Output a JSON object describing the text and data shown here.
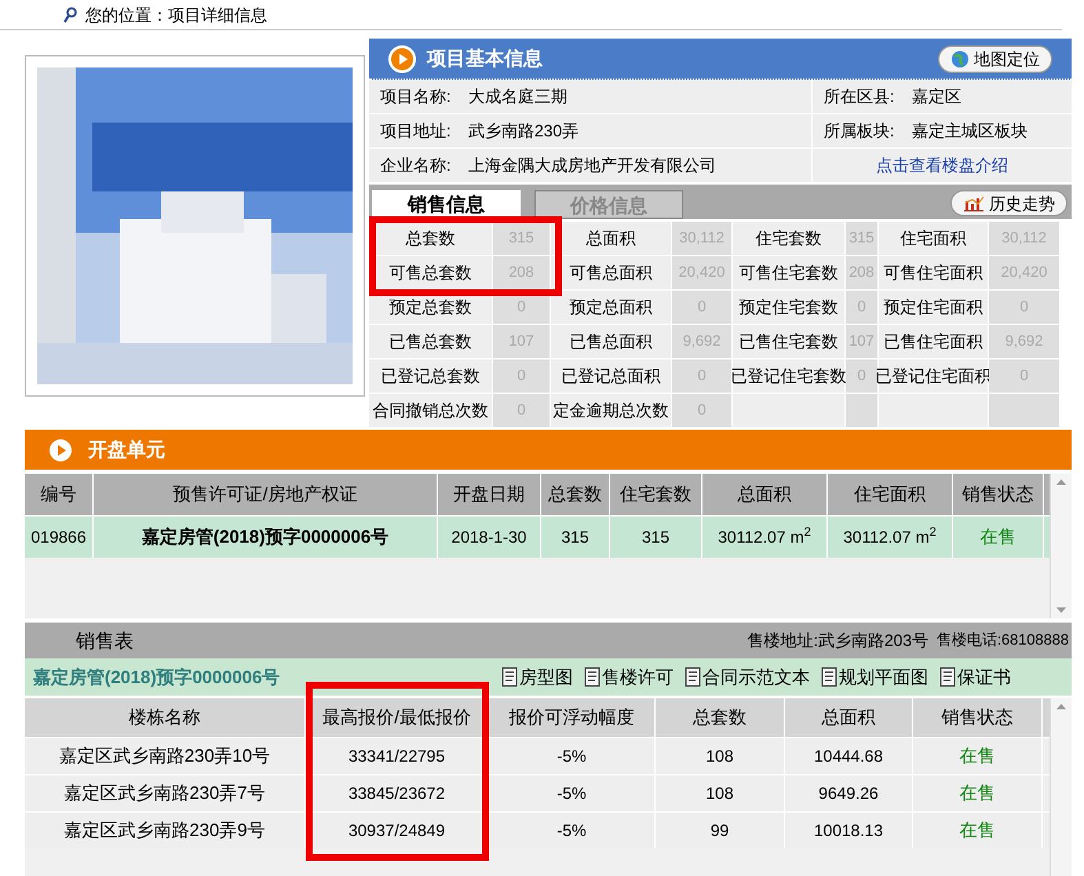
{
  "breadcrumb": "您的位置：项目详细信息",
  "project": {
    "title": "项目基本信息",
    "map_button": "地图定位",
    "rows": [
      {
        "pairs": [
          {
            "label": "项目名称:",
            "value": "大成名庭三期"
          },
          {
            "label": "所在区县:",
            "value": "嘉定区"
          }
        ]
      },
      {
        "pairs": [
          {
            "label": "项目地址:",
            "value": "武乡南路230弄"
          },
          {
            "label": "所属板块:",
            "value": "嘉定主城区板块"
          }
        ]
      },
      {
        "pairs": [
          {
            "label": "企业名称:",
            "value": "上海金隅大成房地产开发有限公司"
          }
        ],
        "link": "点击查看楼盘介绍"
      }
    ]
  },
  "tabs": [
    {
      "label": "销售信息",
      "selected": true
    },
    {
      "label": "价格信息",
      "selected": false
    }
  ],
  "history_button": "历史走势",
  "stats": [
    {
      "highlighted": true,
      "pairs": [
        {
          "label": "总套数",
          "value": "315"
        },
        {
          "label": "总面积",
          "value": "30,112"
        },
        {
          "label": "住宅套数",
          "value": "315"
        },
        {
          "label": "住宅面积",
          "value": "30,112"
        }
      ]
    },
    {
      "highlighted": true,
      "pairs": [
        {
          "label": "可售总套数",
          "value": "208"
        },
        {
          "label": "可售总面积",
          "value": "20,420"
        },
        {
          "label": "可售住宅套数",
          "value": "208"
        },
        {
          "label": "可售住宅面积",
          "value": "20,420"
        }
      ]
    },
    {
      "highlighted": false,
      "pairs": [
        {
          "label": "预定总套数",
          "value": "0"
        },
        {
          "label": "预定总面积",
          "value": "0"
        },
        {
          "label": "预定住宅套数",
          "value": "0"
        },
        {
          "label": "预定住宅面积",
          "value": "0"
        }
      ]
    },
    {
      "highlighted": false,
      "pairs": [
        {
          "label": "已售总套数",
          "value": "107"
        },
        {
          "label": "已售总面积",
          "value": "9,692"
        },
        {
          "label": "已售住宅套数",
          "value": "107"
        },
        {
          "label": "已售住宅面积",
          "value": "9,692"
        }
      ]
    },
    {
      "highlighted": false,
      "pairs": [
        {
          "label": "已登记总套数",
          "value": "0"
        },
        {
          "label": "已登记总面积",
          "value": "0"
        },
        {
          "label": "已登记住宅套数",
          "value": "0"
        },
        {
          "label": "已登记住宅面积",
          "value": "0"
        }
      ]
    },
    {
      "highlighted": false,
      "pairs": [
        {
          "label": "合同撤销总次数",
          "value": "0"
        },
        {
          "label": "定金逾期总次数",
          "value": "0"
        }
      ]
    }
  ],
  "units": {
    "title": "开盘单元",
    "columns": [
      "编号",
      "预售许可证/房地产权证",
      "开盘日期",
      "总套数",
      "住宅套数",
      "总面积",
      "住宅面积",
      "销售状态"
    ],
    "rows": [
      {
        "cells": [
          "019866",
          "嘉定房管(2018)预字0000006号",
          "2018-1-30",
          "315",
          "315",
          "30112.07 m$^{2}$",
          "30112.07 m$^{2}$",
          "在售"
        ]
      }
    ]
  },
  "sales": {
    "title": "销售表",
    "address": "售楼地址:武乡南路203号",
    "phone": "售楼电话:68108888",
    "permit": "嘉定房管(2018)预字0000006号",
    "links": [
      "房型图",
      "售楼许可",
      "合同示范文本",
      "规划平面图",
      "保证书"
    ],
    "columns": [
      {
        "label": "楼栋名称",
        "highlighted": false
      },
      {
        "label": "最高报价/最低报价",
        "highlighted": true
      },
      {
        "label": "报价可浮动幅度",
        "highlighted": false
      },
      {
        "label": "总套数",
        "highlighted": false
      },
      {
        "label": "总面积",
        "highlighted": false
      },
      {
        "label": "销售状态",
        "highlighted": false
      }
    ],
    "rows": [
      {
        "cells": [
          "嘉定区武乡南路230弄10号",
          "33341/22795",
          "-5%",
          "108",
          "10444.68",
          "在售"
        ]
      },
      {
        "cells": [
          "嘉定区武乡南路230弄7号",
          "33845/23672",
          "-5%",
          "108",
          "9649.26",
          "在售"
        ]
      },
      {
        "cells": [
          "嘉定区武乡南路230弄9号",
          "30937/24849",
          "-5%",
          "99",
          "10018.13",
          "在售"
        ]
      }
    ]
  }
}
